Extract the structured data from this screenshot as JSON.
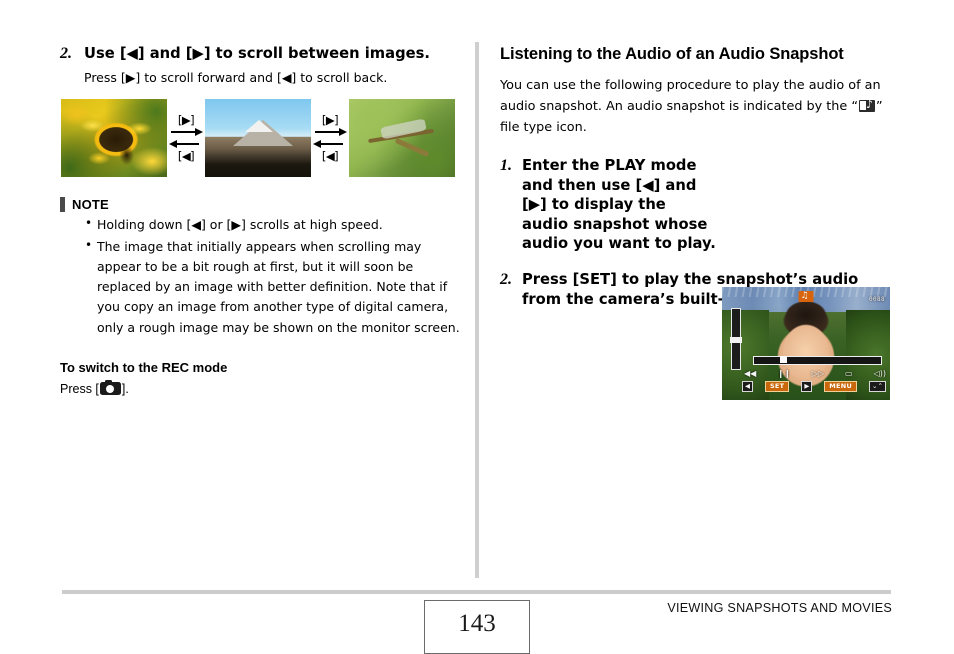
{
  "left_column": {
    "step": {
      "number": "2.",
      "heading": "Use [◀] and [▶] to scroll between images.",
      "subtext": "Press [▶] to scroll forward and [◀] to scroll back."
    },
    "thumbnails": [
      {
        "name": "yellow-flowers-photo",
        "alt": "Yellow black-eyed-susan flowers"
      },
      {
        "name": "mount-fuji-photo",
        "alt": "Mount Fuji landscape"
      },
      {
        "name": "dragonfly-photo",
        "alt": "Dragonfly on a branch"
      }
    ],
    "arrow_groups": [
      {
        "forward_key": "[▶]",
        "back_key": "[◀]"
      },
      {
        "forward_key": "[▶]",
        "back_key": "[◀]"
      }
    ],
    "note": {
      "label": "NOTE",
      "items": [
        "Holding down [◀] or [▶] scrolls at high speed.",
        "The image that initially appears when scrolling may appear to be a bit rough at first, but it will soon be replaced by an image with better definition. Note that if you copy an image from another type of digital camera, only a rough image may be shown on the monitor screen."
      ]
    },
    "rec_mode": {
      "heading": "To switch to the REC mode",
      "text_before_icon": "Press [",
      "text_after_icon": "].",
      "icon": "camera-icon"
    }
  },
  "right_column": {
    "heading": "Listening to the Audio of an Audio Snapshot",
    "intro_before_icon": "You can use the following procedure to play the audio of an audio snapshot. An audio snapshot is indicated by the “",
    "intro_icon": "audio-file-type-icon",
    "intro_after_icon": "” file type icon.",
    "steps": [
      {
        "number": "1.",
        "text": "Enter the PLAY mode and then use [◀] and [▶] to display the audio snapshot whose audio you want to play."
      },
      {
        "number": "2.",
        "text": "Press [SET] to play the snapshot’s audio from the camera’s built-in speaker."
      }
    ],
    "lcd_screenshot": {
      "name": "camera-lcd-screenshot",
      "alt": "Camera monitor showing a girl in a strawberry field with audio playback controls",
      "top_right_text": "0088",
      "audio_badge_icon": "audio-snapshot-badge-icon",
      "controls": [
        {
          "icon": "rewind-icon",
          "glyph": "◀◀"
        },
        {
          "icon": "pause-icon",
          "glyph": "❙❙"
        },
        {
          "icon": "fast-forward-icon",
          "glyph": "▷▷"
        },
        {
          "icon": "stop-icon",
          "glyph": "▭"
        },
        {
          "icon": "volume-icon",
          "glyph": "◁))"
        }
      ],
      "key_chips": [
        {
          "icon": "left-key-chip",
          "label": "◀"
        },
        {
          "icon": "set-key-chip",
          "label": "SET"
        },
        {
          "icon": "right-key-chip",
          "label": "▶"
        },
        {
          "icon": "menu-key-chip",
          "label": "MENU"
        },
        {
          "icon": "zoom-key-chip",
          "label": "⌄⌃"
        }
      ]
    }
  },
  "footer": {
    "page_number": "143",
    "section_title": "VIEWING SNAPSHOTS AND MOVIES"
  },
  "colors": {
    "rule": "#cccccc",
    "divider": "#cfcfcf",
    "note_bar": "#4a4a4a",
    "accent_amber": "#c9680a"
  }
}
